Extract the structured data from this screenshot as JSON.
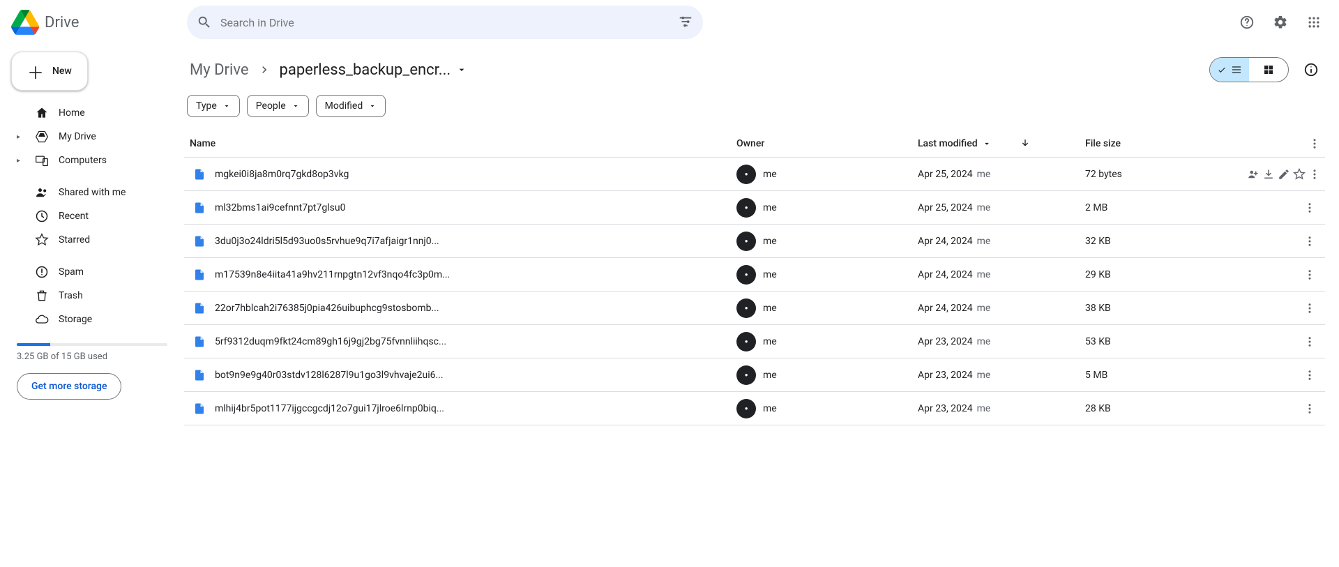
{
  "product_name": "Drive",
  "search": {
    "placeholder": "Search in Drive"
  },
  "sidebar": {
    "new_label": "New",
    "items": [
      {
        "label": "Home",
        "icon": "home"
      },
      {
        "label": "My Drive",
        "icon": "drive",
        "expandable": true
      },
      {
        "label": "Computers",
        "icon": "devices",
        "expandable": true
      },
      {
        "label": "Shared with me",
        "icon": "people"
      },
      {
        "label": "Recent",
        "icon": "clock"
      },
      {
        "label": "Starred",
        "icon": "star"
      },
      {
        "label": "Spam",
        "icon": "spam"
      },
      {
        "label": "Trash",
        "icon": "trash"
      },
      {
        "label": "Storage",
        "icon": "cloud"
      }
    ],
    "storage": {
      "used_text": "3.25 GB of 15 GB used",
      "percent": 22,
      "get_more": "Get more storage"
    }
  },
  "breadcrumb": {
    "root": "My Drive",
    "current": "paperless_backup_encr..."
  },
  "filters": {
    "type": "Type",
    "people": "People",
    "modified": "Modified"
  },
  "columns": {
    "name": "Name",
    "owner": "Owner",
    "modified": "Last modified",
    "size": "File size"
  },
  "owner_me": "me",
  "files": [
    {
      "name": "mgkei0i8ja8m0rq7gkd8op3vkg",
      "modified": "Apr 25, 2024",
      "by": "me",
      "size": "72 bytes"
    },
    {
      "name": "ml32bms1ai9cefnnt7pt7glsu0",
      "modified": "Apr 25, 2024",
      "by": "me",
      "size": "2 MB"
    },
    {
      "name": "3du0j3o24ldri5l5d93uo0s5rvhue9q7i7afjaigr1nnj0...",
      "modified": "Apr 24, 2024",
      "by": "me",
      "size": "32 KB"
    },
    {
      "name": "m17539n8e4iita41a9hv211rnpgtn12vf3nqo4fc3p0m...",
      "modified": "Apr 24, 2024",
      "by": "me",
      "size": "29 KB"
    },
    {
      "name": "22or7hblcah2i76385j0pia426uibuphcg9stosbomb...",
      "modified": "Apr 24, 2024",
      "by": "me",
      "size": "38 KB"
    },
    {
      "name": "5rf9312duqm9fkt24cm89gh16j9gj2bg75fvnnliihqsc...",
      "modified": "Apr 23, 2024",
      "by": "me",
      "size": "53 KB"
    },
    {
      "name": "bot9n9e9g40r03stdv128l6287l9u1go3l9vhvaje2ui6...",
      "modified": "Apr 23, 2024",
      "by": "me",
      "size": "5 MB"
    },
    {
      "name": "mlhij4br5pot1177ijgccgcdj12o7gui17jlroe6lrnp0biq...",
      "modified": "Apr 23, 2024",
      "by": "me",
      "size": "28 KB"
    }
  ]
}
